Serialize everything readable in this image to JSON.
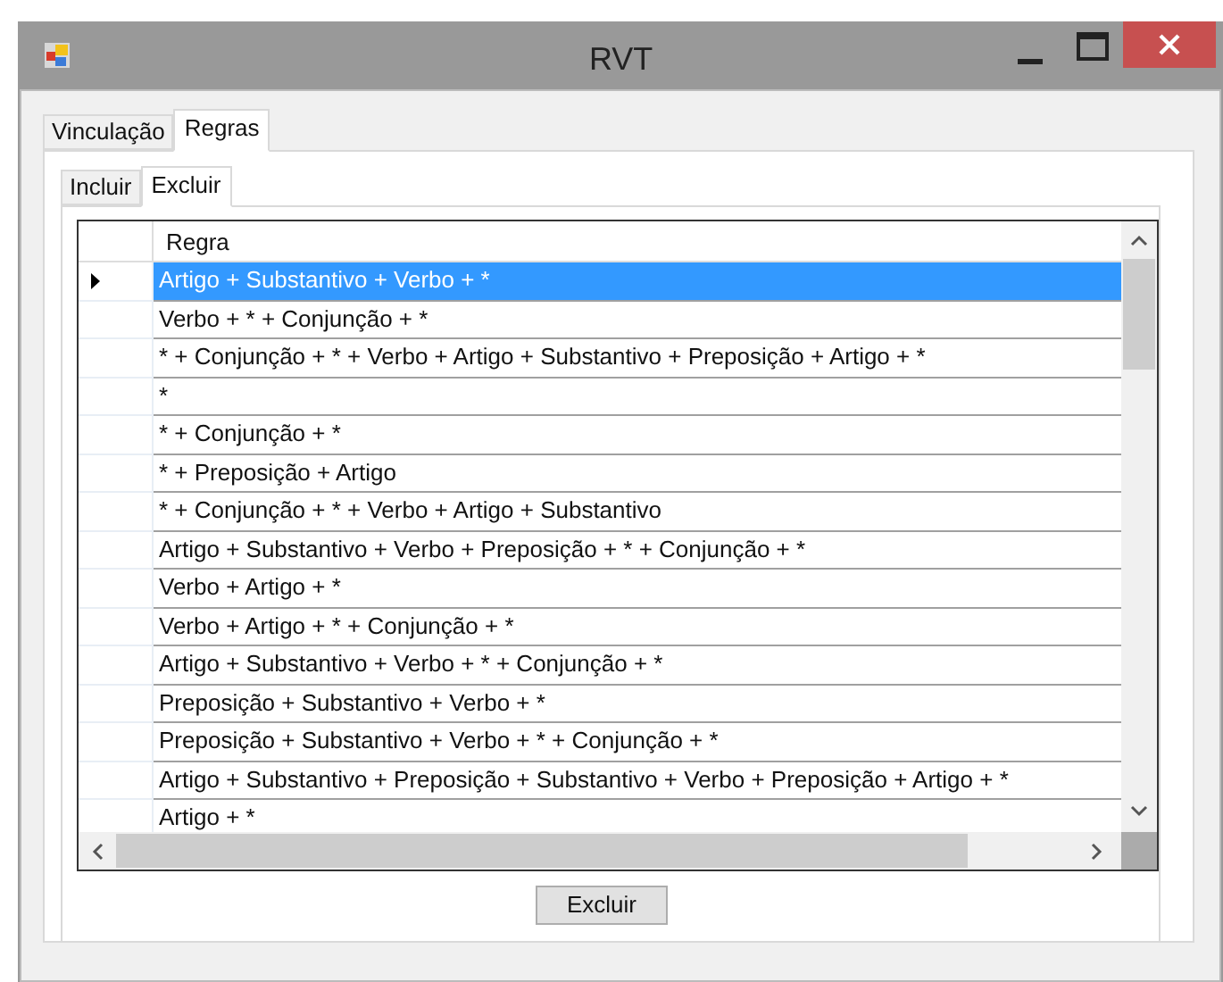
{
  "window": {
    "title": "RVT"
  },
  "tabs": [
    {
      "label": "Vinculação",
      "selected": false
    },
    {
      "label": "Regras",
      "selected": true
    }
  ],
  "subtabs": [
    {
      "label": "Incluir",
      "selected": false
    },
    {
      "label": "Excluir",
      "selected": true
    }
  ],
  "table": {
    "columns": [
      "Regra"
    ],
    "rows": [
      {
        "cell": "Artigo + Substantivo + Verbo + *",
        "selected": true
      },
      {
        "cell": "Verbo + * + Conjunção + *",
        "selected": false
      },
      {
        "cell": "* + Conjunção + * + Verbo + Artigo + Substantivo + Preposição + Artigo + *",
        "selected": false
      },
      {
        "cell": "*",
        "selected": false
      },
      {
        "cell": "* + Conjunção + *",
        "selected": false
      },
      {
        "cell": "* + Preposição + Artigo",
        "selected": false
      },
      {
        "cell": "* + Conjunção + * + Verbo + Artigo + Substantivo",
        "selected": false
      },
      {
        "cell": "Artigo + Substantivo + Verbo + Preposição + * + Conjunção + *",
        "selected": false
      },
      {
        "cell": "Verbo + Artigo + *",
        "selected": false
      },
      {
        "cell": "Verbo + Artigo + * + Conjunção + *",
        "selected": false
      },
      {
        "cell": "Artigo + Substantivo + Verbo + * + Conjunção + *",
        "selected": false
      },
      {
        "cell": "Preposição + Substantivo + Verbo + *",
        "selected": false
      },
      {
        "cell": "Preposição + Substantivo + Verbo + * + Conjunção + *",
        "selected": false
      },
      {
        "cell": "Artigo + Substantivo + Preposição + Substantivo + Verbo + Preposição + Artigo + *",
        "selected": false
      },
      {
        "cell": "Artigo + *",
        "selected": false
      }
    ]
  },
  "button": "Excluir"
}
